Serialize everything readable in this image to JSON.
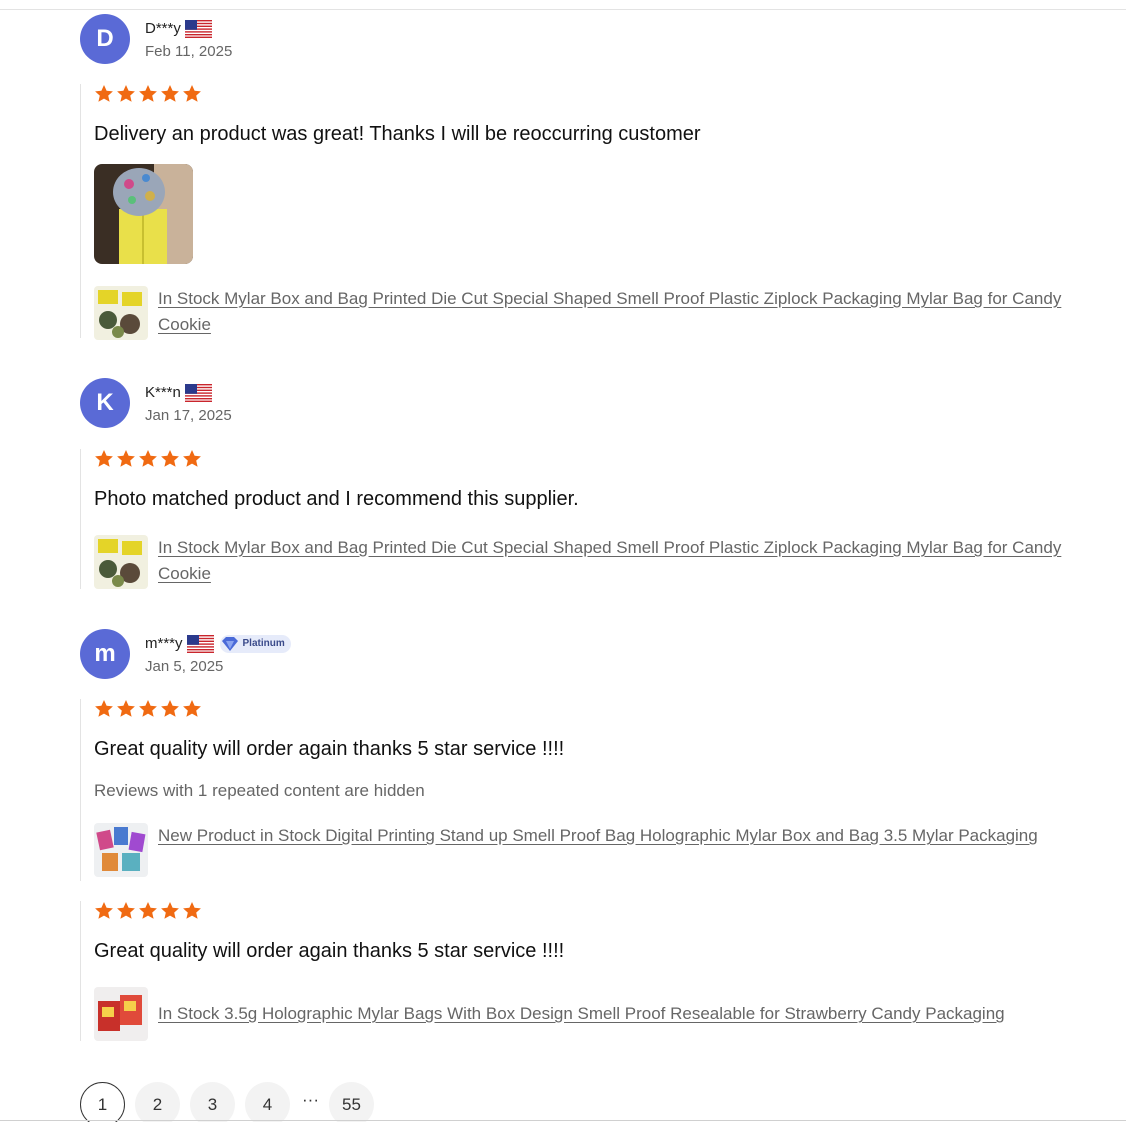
{
  "colors": {
    "avatar": "#5a6ad6",
    "star": "#f06a12",
    "link": "#666666"
  },
  "reviews": [
    {
      "initial": "D",
      "name": "D***y",
      "flag": "us-flag-icon",
      "date": "Feb 11, 2025",
      "entries": [
        {
          "rating": 5,
          "text": "Delivery an product was great! Thanks I will be reoccurring customer",
          "product": "In Stock Mylar Box and Bag Printed Die Cut Special Shaped Smell Proof Plastic Ziplock Packaging Mylar Bag for Candy Cookie"
        }
      ]
    },
    {
      "initial": "K",
      "name": "K***n",
      "flag": "us-flag-icon",
      "date": "Jan 17, 2025",
      "entries": [
        {
          "rating": 5,
          "text": "Photo matched product and I recommend this supplier.",
          "product": "In Stock Mylar Box and Bag Printed Die Cut Special Shaped Smell Proof Plastic Ziplock Packaging Mylar Bag for Candy Cookie"
        }
      ]
    },
    {
      "initial": "m",
      "name": "m***y",
      "flag": "us-flag-icon",
      "badge": "Platinum",
      "date": "Jan 5, 2025",
      "entries": [
        {
          "rating": 5,
          "text": "Great quality will order again thanks 5 star service !!!!",
          "hidden_note": "Reviews with 1 repeated content are hidden",
          "product": "New Product in Stock Digital Printing Stand up Smell Proof Bag Holographic Mylar Box and Bag 3.5 Mylar Packaging"
        },
        {
          "rating": 5,
          "text": "Great quality will order again thanks 5 star service !!!!",
          "product": "In Stock 3.5g Holographic Mylar Bags With Box Design Smell Proof Resealable for Strawberry Candy Packaging"
        }
      ]
    }
  ],
  "pagination": {
    "pages": [
      "1",
      "2",
      "3",
      "4"
    ],
    "ellipsis": "···",
    "last": "55",
    "current": "1"
  }
}
